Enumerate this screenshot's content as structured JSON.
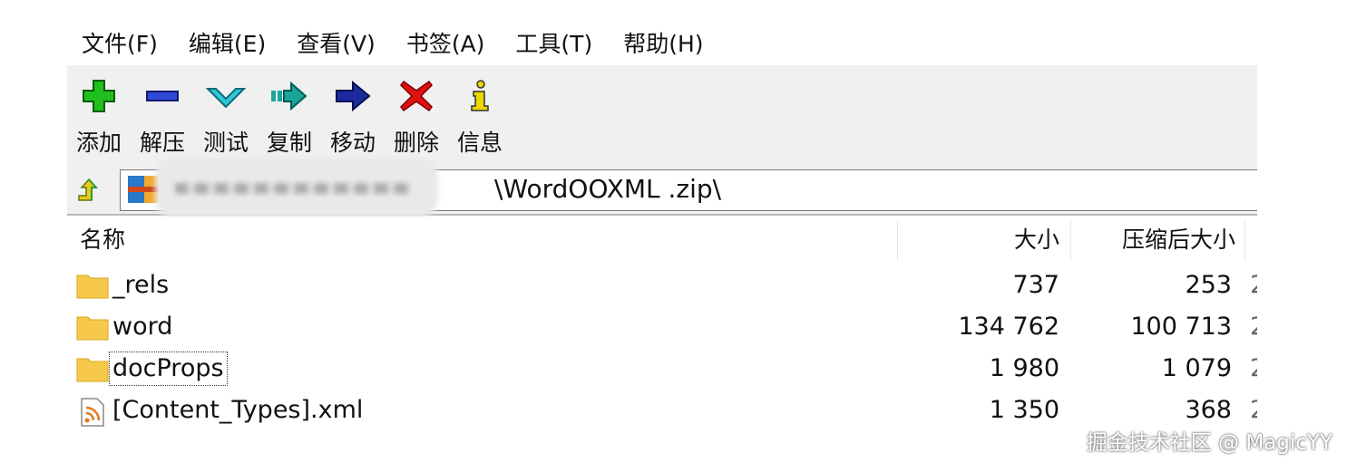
{
  "menu": [
    "文件(F)",
    "编辑(E)",
    "查看(V)",
    "书签(A)",
    "工具(T)",
    "帮助(H)"
  ],
  "toolbar": [
    {
      "label": "添加",
      "icon": "add-icon"
    },
    {
      "label": "解压",
      "icon": "extract-icon"
    },
    {
      "label": "测试",
      "icon": "test-icon"
    },
    {
      "label": "复制",
      "icon": "copy-icon"
    },
    {
      "label": "移动",
      "icon": "move-icon"
    },
    {
      "label": "删除",
      "icon": "delete-icon"
    },
    {
      "label": "信息",
      "icon": "info-icon"
    }
  ],
  "address": {
    "path_visible": "\\WordOOXML .zip\\"
  },
  "columns": {
    "name": "名称",
    "size": "大小",
    "packed": "压缩后大小"
  },
  "files": [
    {
      "name": "_rels",
      "type": "folder",
      "size": "737",
      "packed": "253",
      "extra": "2"
    },
    {
      "name": "word",
      "type": "folder",
      "size": "134 762",
      "packed": "100 713",
      "extra": "2"
    },
    {
      "name": "docProps",
      "type": "folder",
      "size": "1 980",
      "packed": "1 079",
      "extra": "2"
    },
    {
      "name": "[Content_Types].xml",
      "type": "xml-file",
      "size": "1 350",
      "packed": "368",
      "extra": "2"
    }
  ],
  "watermark": "掘金技术社区 @ MagicYY",
  "colors": {
    "folder": "#f6c94a",
    "toolbar_bg": "#f0f0f0",
    "add": "#1fbf1f",
    "extract": "#2f48d8",
    "test": "#2fc8d8",
    "copy": "#1aa59a",
    "move": "#1c2aa0",
    "delete": "#e01010",
    "info": "#e8d800"
  }
}
